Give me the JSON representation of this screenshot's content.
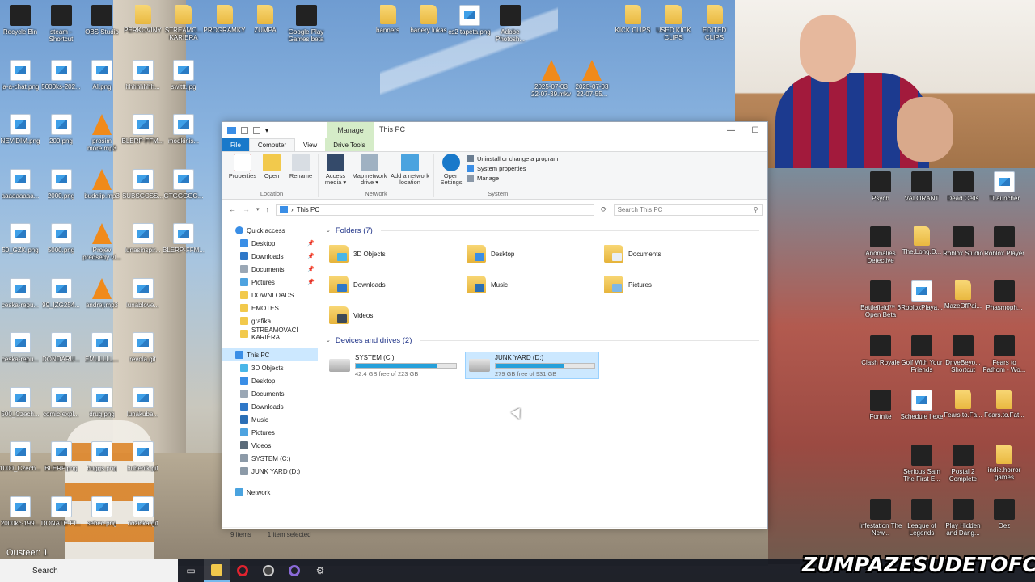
{
  "desktop_left": [
    {
      "label": "Recycle Bin",
      "kind": "app",
      "col": 0,
      "row": 0
    },
    {
      "label": "steam - Shortcut",
      "kind": "app",
      "col": 1,
      "row": 0
    },
    {
      "label": "OBS Studio",
      "kind": "app",
      "col": 2,
      "row": 0
    },
    {
      "label": "PERKOVINY",
      "kind": "folder",
      "col": 3,
      "row": 0
    },
    {
      "label": "STREAMO... KARIERA",
      "kind": "folder",
      "col": 4,
      "row": 0
    },
    {
      "label": "PROGRAMKY",
      "kind": "folder",
      "col": 5,
      "row": 0
    },
    {
      "label": "ZUMPA",
      "kind": "folder",
      "col": 6,
      "row": 0
    },
    {
      "label": "Google Play Games beta",
      "kind": "app",
      "col": 7,
      "row": 0
    },
    {
      "label": "banners",
      "kind": "folder",
      "col": 9,
      "row": 0
    },
    {
      "label": "banery lukas",
      "kind": "folder",
      "col": 10,
      "row": 0
    },
    {
      "label": "cs2 tapeta.png",
      "kind": "img",
      "col": 11,
      "row": 0
    },
    {
      "label": "Adobe Photosh...",
      "kind": "app",
      "col": 12,
      "row": 0
    },
    {
      "label": "KICK CLIPS",
      "kind": "folder",
      "col": 15,
      "row": 0
    },
    {
      "label": "USED KICK CLIPS",
      "kind": "folder",
      "col": 16,
      "row": 0
    },
    {
      "label": "EDITED CLIPS",
      "kind": "folder",
      "col": 17,
      "row": 0
    },
    {
      "label": "ja-a-chat.png",
      "kind": "img",
      "col": 0,
      "row": 1
    },
    {
      "label": "5000ks-202...",
      "kind": "img",
      "col": 1,
      "row": 1
    },
    {
      "label": "AI.png",
      "kind": "img",
      "col": 2,
      "row": 1
    },
    {
      "label": "hhhhhhhh...",
      "kind": "img",
      "col": 3,
      "row": 1
    },
    {
      "label": "swittt.jpg",
      "kind": "img",
      "col": 4,
      "row": 1
    },
    {
      "label": "2025-07-03 22-07-39.mkv",
      "kind": "vlc",
      "col": 13,
      "row": 1
    },
    {
      "label": "2025-07-03 22-07-55...",
      "kind": "vlc",
      "col": 14,
      "row": 1
    },
    {
      "label": "NEVIDIM.png",
      "kind": "img",
      "col": 0,
      "row": 2
    },
    {
      "label": "200.png",
      "kind": "img",
      "col": 1,
      "row": 2
    },
    {
      "label": "prosim more.mp3",
      "kind": "vlc",
      "col": 2,
      "row": 2
    },
    {
      "label": "BLERP-FFM...",
      "kind": "img",
      "col": 3,
      "row": 2
    },
    {
      "label": "modkinis...",
      "kind": "img",
      "col": 4,
      "row": 2
    },
    {
      "label": "aaaaaaaaa...",
      "kind": "img",
      "col": 0,
      "row": 3
    },
    {
      "label": "2000.png",
      "kind": "img",
      "col": 1,
      "row": 3
    },
    {
      "label": "budelip.mp3",
      "kind": "vlc",
      "col": 2,
      "row": 3
    },
    {
      "label": "SUBSGCSS...",
      "kind": "img",
      "col": 3,
      "row": 3
    },
    {
      "label": "GTGGGGG...",
      "kind": "img",
      "col": 4,
      "row": 3
    },
    {
      "label": "50_GZK.png",
      "kind": "img",
      "col": 0,
      "row": 4
    },
    {
      "label": "5000.png",
      "kind": "img",
      "col": 1,
      "row": 4
    },
    {
      "label": "Projev predsedy vl...",
      "kind": "vlc",
      "col": 2,
      "row": 4
    },
    {
      "label": "lunasinspir...",
      "kind": "img",
      "col": 3,
      "row": 4
    },
    {
      "label": "BLERP-FFM...",
      "kind": "img",
      "col": 4,
      "row": 4
    },
    {
      "label": "ceska-repu...",
      "kind": "img",
      "col": 0,
      "row": 5
    },
    {
      "label": "99_IZG254...",
      "kind": "img",
      "col": 1,
      "row": 5
    },
    {
      "label": "andrej.mp3",
      "kind": "vlc",
      "col": 2,
      "row": 5
    },
    {
      "label": "lunablove...",
      "kind": "img",
      "col": 3,
      "row": 5
    },
    {
      "label": "ceska-repu...",
      "kind": "img",
      "col": 0,
      "row": 6
    },
    {
      "label": "DONDARU...",
      "kind": "img",
      "col": 1,
      "row": 6
    },
    {
      "label": "EMULLLL...",
      "kind": "img",
      "col": 2,
      "row": 6
    },
    {
      "label": "revola.gif",
      "kind": "img",
      "col": 3,
      "row": 6
    },
    {
      "label": "500_Czech...",
      "kind": "img",
      "col": 0,
      "row": 7
    },
    {
      "label": "comic-expl...",
      "kind": "img",
      "col": 1,
      "row": 7
    },
    {
      "label": "drug.png",
      "kind": "img",
      "col": 2,
      "row": 7
    },
    {
      "label": "lunakuba...",
      "kind": "img",
      "col": 3,
      "row": 7
    },
    {
      "label": "1000_Czech...",
      "kind": "img",
      "col": 0,
      "row": 8
    },
    {
      "label": "BLERP.png",
      "kind": "img",
      "col": 1,
      "row": 8
    },
    {
      "label": "buggs.png",
      "kind": "img",
      "col": 2,
      "row": 8
    },
    {
      "label": "bubenik.gif",
      "kind": "img",
      "col": 3,
      "row": 8
    },
    {
      "label": "2000kc-199...",
      "kind": "img",
      "col": 0,
      "row": 9
    },
    {
      "label": "DONATE-FI...",
      "kind": "img",
      "col": 1,
      "row": 9
    },
    {
      "label": "sebec.png",
      "kind": "img",
      "col": 2,
      "row": 9
    },
    {
      "label": "nozicka.gif",
      "kind": "img",
      "col": 3,
      "row": 9
    }
  ],
  "desktop_right": [
    {
      "label": "Psych",
      "kind": "app",
      "col": 0,
      "row": 0
    },
    {
      "label": "VALORANT",
      "kind": "app",
      "col": 1,
      "row": 0
    },
    {
      "label": "Dead Cells",
      "kind": "app",
      "col": 2,
      "row": 0
    },
    {
      "label": "TLauncher",
      "kind": "img",
      "col": 3,
      "row": 0
    },
    {
      "label": "Anomalies Detective",
      "kind": "app",
      "col": 0,
      "row": 1
    },
    {
      "label": "The.Long.D...",
      "kind": "folder",
      "col": 1,
      "row": 1
    },
    {
      "label": "Roblox Studio",
      "kind": "app",
      "col": 2,
      "row": 1
    },
    {
      "label": "Roblox Player",
      "kind": "app",
      "col": 3,
      "row": 1
    },
    {
      "label": "Battlefield™ 6 Open Beta",
      "kind": "app",
      "col": 0,
      "row": 2
    },
    {
      "label": "RobloxPlaya...",
      "kind": "img",
      "col": 1,
      "row": 2
    },
    {
      "label": "MazeOfPai...",
      "kind": "folder",
      "col": 2,
      "row": 2
    },
    {
      "label": "Phasmoph...",
      "kind": "app",
      "col": 3,
      "row": 2
    },
    {
      "label": "Clash Royale",
      "kind": "app",
      "col": 0,
      "row": 3
    },
    {
      "label": "Golf With Your Friends",
      "kind": "app",
      "col": 1,
      "row": 3
    },
    {
      "label": "DriveBeyo... Shortcut",
      "kind": "app",
      "col": 2,
      "row": 3
    },
    {
      "label": "Fears to Fathom - Wo...",
      "kind": "app",
      "col": 3,
      "row": 3
    },
    {
      "label": "Fortnite",
      "kind": "app",
      "col": 0,
      "row": 4
    },
    {
      "label": "Schedule I.exe",
      "kind": "img",
      "col": 1,
      "row": 4
    },
    {
      "label": "Fears.to.Fa...",
      "kind": "folder",
      "col": 2,
      "row": 4
    },
    {
      "label": "Fears.to.Fat...",
      "kind": "folder",
      "col": 3,
      "row": 4
    },
    {
      "label": "Serious Sam The First E...",
      "kind": "app",
      "col": 1,
      "row": 5
    },
    {
      "label": "Postal 2 Complete",
      "kind": "app",
      "col": 2,
      "row": 5
    },
    {
      "label": "indie.horror games",
      "kind": "folder",
      "col": 3,
      "row": 5
    },
    {
      "label": "Infestation The New...",
      "kind": "app",
      "col": 0,
      "row": 6
    },
    {
      "label": "League of Legends",
      "kind": "app",
      "col": 1,
      "row": 6
    },
    {
      "label": "Play Hidden and Dang...",
      "kind": "app",
      "col": 2,
      "row": 6
    },
    {
      "label": "Oez",
      "kind": "app",
      "col": 3,
      "row": 6
    }
  ],
  "window": {
    "title": "This PC",
    "manage_tab": "Manage",
    "controls": {
      "minimize": "—",
      "maximize": "☐"
    },
    "tabs": {
      "file": "File",
      "computer": "Computer",
      "view": "View",
      "drive_tools": "Drive Tools"
    },
    "ribbon": {
      "location": {
        "label": "Location",
        "buttons": [
          "Properties",
          "Open",
          "Rename"
        ]
      },
      "network": {
        "label": "Network",
        "buttons": [
          "Access media ▾",
          "Map network drive ▾",
          "Add a network location"
        ]
      },
      "system": {
        "label": "System",
        "open_settings": "Open Settings",
        "items": [
          "Uninstall or change a program",
          "System properties",
          "Manage"
        ]
      }
    },
    "address": {
      "path": "This PC",
      "search_placeholder": "Search This PC"
    },
    "nav": {
      "quick_access": "Quick access",
      "quick_items": [
        {
          "label": "Desktop",
          "pinned": true,
          "color": "#3a8ee6"
        },
        {
          "label": "Downloads",
          "pinned": true,
          "color": "#2f78c8"
        },
        {
          "label": "Documents",
          "pinned": true,
          "color": "#9aa7b5"
        },
        {
          "label": "Pictures",
          "pinned": true,
          "color": "#4ea3e0"
        },
        {
          "label": "DOWNLOADS",
          "pinned": false,
          "color": "#f2c94c"
        },
        {
          "label": "EMOTES",
          "pinned": false,
          "color": "#f2c94c"
        },
        {
          "label": "grafika",
          "pinned": false,
          "color": "#f2c94c"
        },
        {
          "label": "STREAMOVACÍ KARIÉRA",
          "pinned": false,
          "color": "#f2c94c"
        }
      ],
      "this_pc": "This PC",
      "pc_items": [
        {
          "label": "3D Objects",
          "color": "#49b6e8"
        },
        {
          "label": "Desktop",
          "color": "#3a8ee6"
        },
        {
          "label": "Documents",
          "color": "#9aa7b5"
        },
        {
          "label": "Downloads",
          "color": "#2f78c8"
        },
        {
          "label": "Music",
          "color": "#2b6fb6"
        },
        {
          "label": "Pictures",
          "color": "#4ea3e0"
        },
        {
          "label": "Videos",
          "color": "#5b6b7a"
        },
        {
          "label": "SYSTEM (C:)",
          "color": "#8c9aa8"
        },
        {
          "label": "JUNK YARD (D:)",
          "color": "#8c9aa8"
        }
      ],
      "network": "Network",
      "pin_glyph": "📌"
    },
    "folders_header": "Folders (7)",
    "folders": [
      {
        "label": "3D Objects",
        "badge": "#49b6e8"
      },
      {
        "label": "Desktop",
        "badge": "#3a8ee6"
      },
      {
        "label": "Documents",
        "badge": "#e9eef3"
      },
      {
        "label": "Downloads",
        "badge": "#2f78c8"
      },
      {
        "label": "Music",
        "badge": "#2b6fb6"
      },
      {
        "label": "Pictures",
        "badge": "#7fb7e6"
      },
      {
        "label": "Videos",
        "badge": "#3d4a57"
      }
    ],
    "drives_header": "Devices and drives (2)",
    "drives": [
      {
        "label": "SYSTEM (C:)",
        "free": "42.4 GB free of 223 GB",
        "used_fraction": 0.81,
        "selected": false
      },
      {
        "label": "JUNK YARD (D:)",
        "free": "279 GB free of 931 GB",
        "used_fraction": 0.7,
        "selected": true
      }
    ],
    "status": {
      "items": "9 items",
      "selected": "1 item selected"
    }
  },
  "taskbar": {
    "search_text": "Search"
  },
  "overlay": {
    "chat": "Ousteer: 1",
    "brand": "ZUMPAZESUDETOFC"
  },
  "colors": {
    "accent": "#1979ca",
    "selection": "#cce8ff",
    "drive_bar": "#26a0da",
    "manage": "#d5ecc8"
  }
}
